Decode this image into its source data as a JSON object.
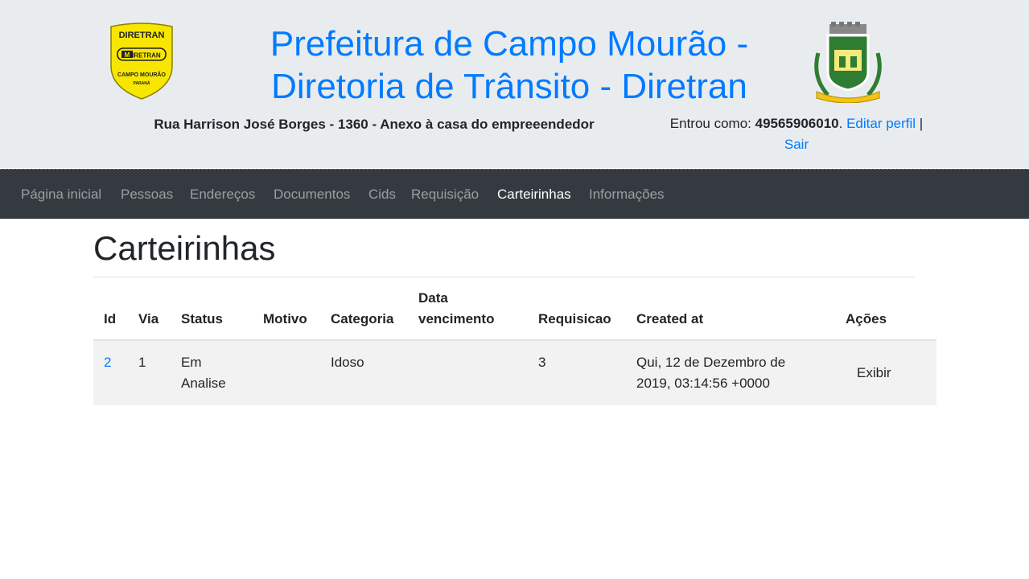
{
  "header": {
    "title": "Prefeitura de Campo Mourão - Diretoria de Trânsito - Diretran",
    "left_logo": {
      "top_text": "DIRETRAN",
      "mid_text": "DIRETRAN",
      "bottom_text": "CAMPO MOURÃO",
      "state_text": "PARANÁ",
      "color": "#f7e600"
    },
    "address": "Rua Harrison José Borges - 1360 - Anexo à casa do empreeendedor",
    "user": {
      "prefix": "Entrou como: ",
      "id": "49565906010",
      "period": ".",
      "edit_profile": "Editar perfil",
      "separator": " | ",
      "logout": "Sair"
    }
  },
  "nav": {
    "items": [
      {
        "label": "Página inicial",
        "active": false
      },
      {
        "label": "Pessoas",
        "active": false
      },
      {
        "label": "Endereços",
        "active": false
      },
      {
        "label": "Documentos",
        "active": false
      },
      {
        "label": "Cids",
        "active": false
      },
      {
        "label": "Requisição",
        "active": false
      },
      {
        "label": "Carteirinhas",
        "active": true
      },
      {
        "label": "Informações",
        "active": false
      }
    ]
  },
  "main": {
    "page_title": "Carteirinhas",
    "table": {
      "headers": [
        "Id",
        "Via",
        "Status",
        "Motivo",
        "Categoria",
        "Data vencimento",
        "Requisicao",
        "Created at",
        "Ações"
      ],
      "rows": [
        {
          "id": "2",
          "via": "1",
          "status": "Em Analise",
          "motivo": "",
          "categoria": "Idoso",
          "data_vencimento": "",
          "requisicao": "3",
          "created_at": "Qui, 12 de Dezembro de 2019, 03:14:56 +0000",
          "action": "Exibir"
        }
      ]
    }
  },
  "colors": {
    "link": "#007bff",
    "header_bg": "#e9ecef",
    "navbar_bg": "#343a40",
    "row_bg": "#f2f2f2"
  }
}
